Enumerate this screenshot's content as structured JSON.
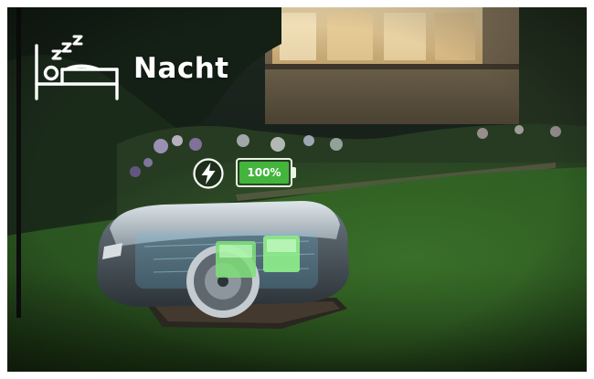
{
  "mode": {
    "icon": "sleeping-bed-icon",
    "label": "Nacht"
  },
  "status": {
    "charging_icon": "lightning-charge-icon",
    "battery_icon": "battery-icon",
    "battery_percent": 100,
    "battery_label": "100%",
    "battery_color": "#43b53c"
  },
  "scene": {
    "image": "robotic-lawn-mower-on-charging-station-at-night"
  }
}
